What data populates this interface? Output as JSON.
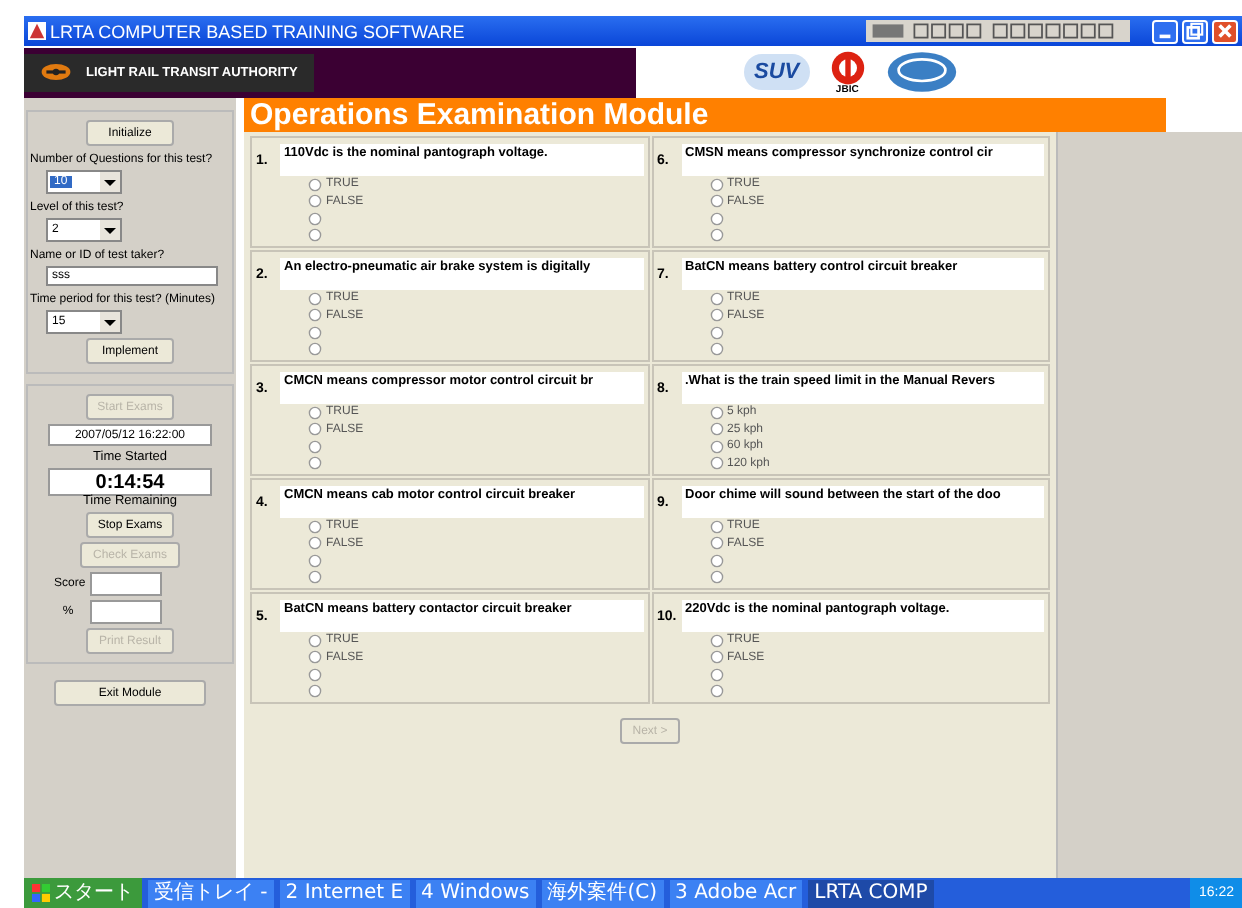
{
  "window": {
    "title": "LRTA COMPUTER BASED TRAINING SOFTWARE"
  },
  "header": {
    "authority": "LIGHT RAIL TRANSIT AUTHORITY",
    "logos": [
      {
        "text": "SUV"
      },
      {
        "text": "JBIC"
      }
    ]
  },
  "module_title": "Operations Examination Module",
  "setup": {
    "initialize": "Initialize",
    "fields": [
      {
        "kind": "select",
        "label": "Number of Questions for this test?",
        "value": "10",
        "highlighted": true
      },
      {
        "kind": "select",
        "label": "Level of this test?",
        "value": "2",
        "highlighted": false
      },
      {
        "kind": "text",
        "label": "Name or ID of test taker?",
        "value": "sss"
      },
      {
        "kind": "select",
        "label": "Time period for this test? (Minutes)",
        "value": "15",
        "highlighted": false
      }
    ],
    "implement": "Implement"
  },
  "exam": {
    "start": {
      "label": "Start Exams",
      "disabled": true
    },
    "time_started": "2007/05/12 16:22:00",
    "time_started_label": "Time Started",
    "time_remaining": "0:14:54",
    "time_remaining_label": "Time Remaining",
    "stop": {
      "label": "Stop Exams",
      "disabled": false
    },
    "check": {
      "label": "Check Exams",
      "disabled": true
    },
    "score_label": "Score",
    "percent_label": "%",
    "print": {
      "label": "Print Result",
      "disabled": true
    }
  },
  "exit": "Exit Module",
  "questions": [
    {
      "number": "1.",
      "text": "110Vdc is the nominal pantograph voltage.",
      "options": [
        {
          "label": "TRUE",
          "selected": false
        },
        {
          "label": "FALSE",
          "selected": false
        },
        {
          "selected": false
        },
        {
          "selected": false
        }
      ]
    },
    {
      "number": "2.",
      "text": "An electro-pneumatic air brake system is digitally",
      "options": [
        {
          "label": "TRUE",
          "selected": false
        },
        {
          "label": "FALSE",
          "selected": false
        },
        {
          "selected": false
        },
        {
          "selected": false
        }
      ]
    },
    {
      "number": "3.",
      "text": "CMCN means compressor motor control circuit br",
      "options": [
        {
          "label": "TRUE",
          "selected": false
        },
        {
          "label": "FALSE",
          "selected": false
        },
        {
          "selected": false
        },
        {
          "selected": false
        }
      ]
    },
    {
      "number": "4.",
      "text": "CMCN means cab motor control circuit breaker",
      "options": [
        {
          "label": "TRUE",
          "selected": false
        },
        {
          "label": "FALSE",
          "selected": false
        },
        {
          "selected": false
        },
        {
          "selected": false
        }
      ]
    },
    {
      "number": "5.",
      "text": "BatCN means battery contactor circuit breaker",
      "options": [
        {
          "label": "TRUE",
          "selected": false
        },
        {
          "label": "FALSE",
          "selected": false
        },
        {
          "selected": false
        },
        {
          "selected": false
        }
      ]
    },
    {
      "number": "6.",
      "text": "CMSN means compressor synchronize control cir",
      "options": [
        {
          "label": "TRUE",
          "selected": false
        },
        {
          "label": "FALSE",
          "selected": false
        },
        {
          "selected": false
        },
        {
          "selected": false
        }
      ]
    },
    {
      "number": "7.",
      "text": "BatCN means battery control circuit breaker",
      "options": [
        {
          "label": "TRUE",
          "selected": false
        },
        {
          "label": "FALSE",
          "selected": false
        },
        {
          "selected": false
        },
        {
          "selected": false
        }
      ]
    },
    {
      "number": "8.",
      "text": ".What is the train speed limit in the Manual Revers",
      "options": [
        {
          "label": "5 kph",
          "selected": false
        },
        {
          "label": "25 kph",
          "selected": false
        },
        {
          "label": "60 kph",
          "selected": false
        },
        {
          "label": "120 kph",
          "selected": false
        }
      ]
    },
    {
      "number": "9.",
      "text": "Door chime will sound between the start of the doo",
      "options": [
        {
          "label": "TRUE",
          "selected": false
        },
        {
          "label": "FALSE",
          "selected": false
        },
        {
          "selected": false
        },
        {
          "selected": false
        }
      ]
    },
    {
      "number": "10.",
      "text": "220Vdc is the nominal pantograph voltage.",
      "options": [
        {
          "label": "TRUE",
          "selected": false
        },
        {
          "label": "FALSE",
          "selected": false
        },
        {
          "selected": false
        },
        {
          "selected": false
        }
      ]
    }
  ],
  "next": {
    "label": "Next >",
    "disabled": true
  },
  "taskbar": {
    "start": "スタート",
    "items": [
      {
        "label": "受信トレイ -",
        "selected": false
      },
      {
        "label": "2 Internet E",
        "selected": false
      },
      {
        "label": "4 Windows",
        "selected": false
      },
      {
        "label": "海外案件(C)",
        "selected": false
      },
      {
        "label": "3 Adobe Acr",
        "selected": false
      },
      {
        "label": "LRTA COMP",
        "selected": true
      }
    ],
    "clock": "16:22"
  }
}
